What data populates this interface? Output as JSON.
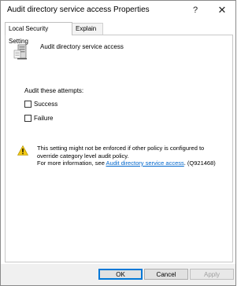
{
  "window": {
    "title": "Audit directory service access Properties",
    "help_glyph": "?",
    "close_glyph": "✕"
  },
  "tabs": [
    {
      "label": "Local Security Setting",
      "active": true
    },
    {
      "label": "Explain",
      "active": false
    }
  ],
  "policy": {
    "icon": "policy-server-icon",
    "name": "Audit directory service access"
  },
  "audit": {
    "heading": "Audit these attempts:",
    "options": [
      {
        "label": "Success",
        "checked": false
      },
      {
        "label": "Failure",
        "checked": false
      }
    ]
  },
  "warning": {
    "icon": "warning-icon",
    "line1": "This setting might not be enforced if other policy is configured to",
    "line2": "override category level audit policy.",
    "line3_prefix": "For more information, see ",
    "link": "Audit directory service access",
    "line3_suffix": ". (Q921468)"
  },
  "buttons": {
    "ok": "OK",
    "cancel": "Cancel",
    "apply": "Apply"
  },
  "colors": {
    "link": "#0066cc",
    "accent": "#0078d7",
    "warning": "#f2c811"
  }
}
